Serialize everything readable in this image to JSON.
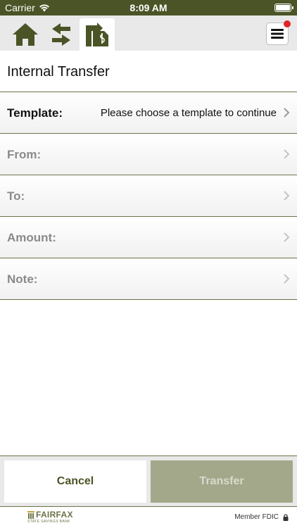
{
  "status_bar": {
    "carrier": "Carrier",
    "time": "8:09 AM"
  },
  "nav": {
    "icons": [
      "home-icon",
      "transfer-arrows-icon",
      "internal-transfer-icon"
    ],
    "active": "internal-transfer-icon",
    "menu_has_notification": true
  },
  "page": {
    "title": "Internal Transfer"
  },
  "form": {
    "template": {
      "label": "Template:",
      "value": "Please choose a template to continue"
    },
    "from": {
      "label": "From:",
      "value": ""
    },
    "to": {
      "label": "To:",
      "value": ""
    },
    "amount": {
      "label": "Amount:",
      "value": ""
    },
    "note": {
      "label": "Note:",
      "value": ""
    }
  },
  "actions": {
    "cancel_label": "Cancel",
    "transfer_label": "Transfer",
    "transfer_enabled": false
  },
  "footer": {
    "logo_main": "FAIRFAX",
    "logo_sub": "STATE SAVINGS BANK",
    "fdic_label": "Member FDIC"
  },
  "colors": {
    "brand": "#4a5426",
    "divider": "#6b7349",
    "disabled_button": "#a3a88a",
    "badge": "#e0242a"
  }
}
